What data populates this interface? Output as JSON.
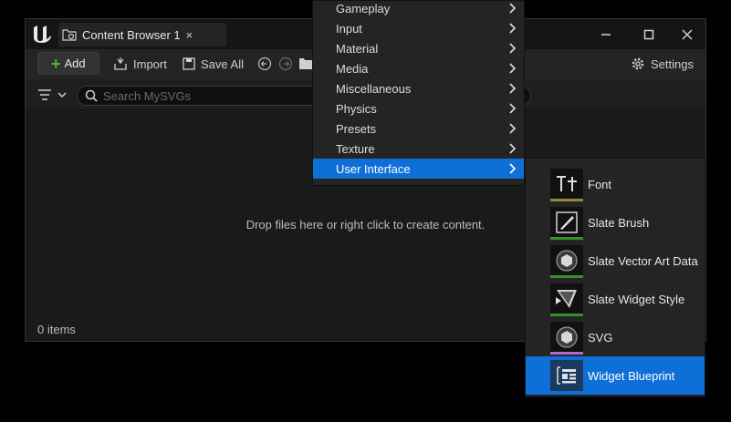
{
  "window": {
    "tab_title": "Content Browser 1",
    "tab_close": "×",
    "minimize": "─",
    "maximize": "□",
    "close": "✕"
  },
  "toolbar": {
    "add_label": "Add",
    "import_label": "Import",
    "save_all_label": "Save All",
    "settings_label": "Settings"
  },
  "search": {
    "placeholder": "Search MySVGs"
  },
  "content": {
    "empty_message": "Drop files here or right click to create content.",
    "item_count": "0 items"
  },
  "menu": {
    "items": [
      {
        "label": "Gameplay"
      },
      {
        "label": "Input"
      },
      {
        "label": "Material"
      },
      {
        "label": "Media"
      },
      {
        "label": "Miscellaneous"
      },
      {
        "label": "Physics"
      },
      {
        "label": "Presets"
      },
      {
        "label": "Texture"
      },
      {
        "label": "User Interface",
        "active": true
      }
    ]
  },
  "submenu": {
    "items": [
      {
        "label": "Font",
        "icon": "font-icon",
        "stripe": "#8f8a3a"
      },
      {
        "label": "Slate Brush",
        "icon": "slate-brush-icon",
        "stripe": "#3a8f2e"
      },
      {
        "label": "Slate Vector Art Data",
        "icon": "vector-art-icon",
        "stripe": "#3a8f2e"
      },
      {
        "label": "Slate Widget Style",
        "icon": "widget-style-icon",
        "stripe": "#3a8f2e"
      },
      {
        "label": "SVG",
        "icon": "svg-icon",
        "stripe": "#b06ad8"
      },
      {
        "label": "Widget Blueprint",
        "icon": "widget-blueprint-icon",
        "stripe": "#1f5fb0",
        "active": true
      }
    ]
  },
  "colors": {
    "accent": "#0f6fd8",
    "add_green": "#57b233"
  }
}
